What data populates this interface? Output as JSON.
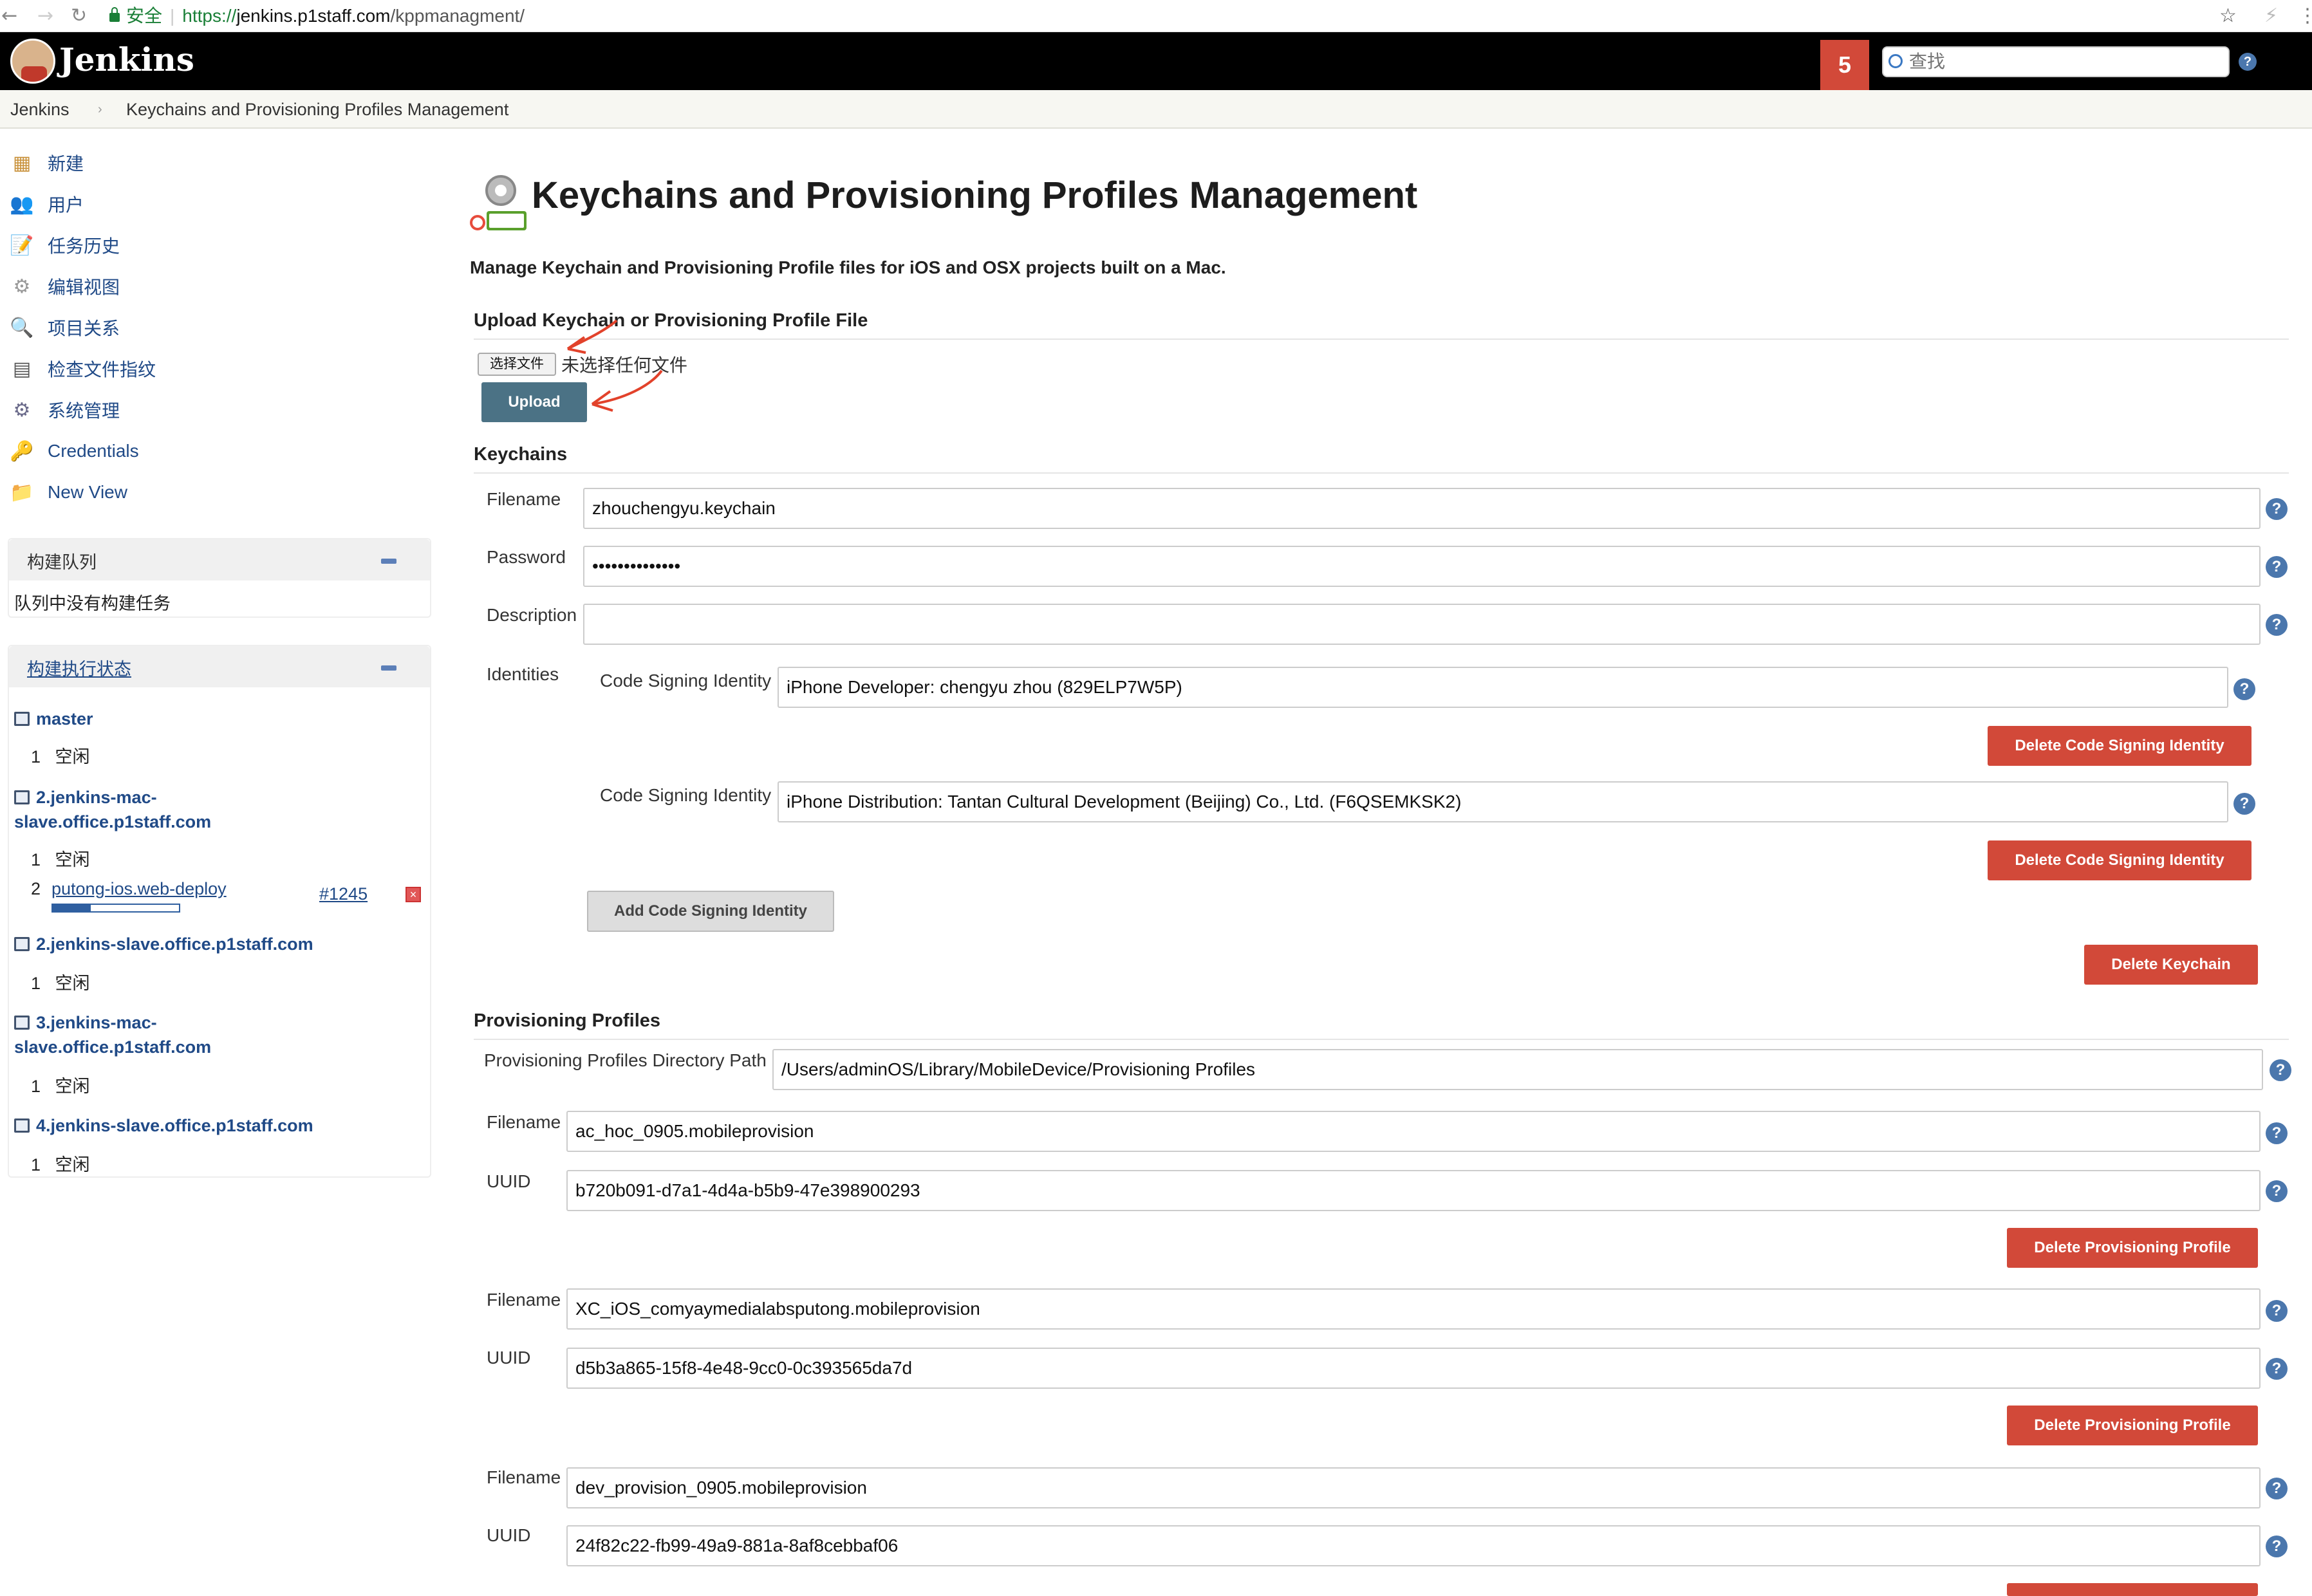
{
  "browser": {
    "secure_label": "安全",
    "url_scheme": "https://",
    "url_host": "jenkins.p1staff.com",
    "url_path": "/kppmanagment/"
  },
  "header": {
    "app_name": "Jenkins",
    "notification_count": "5",
    "search_placeholder": "查找"
  },
  "breadcrumb": [
    "Jenkins",
    "Keychains and Provisioning Profiles Management"
  ],
  "sidebar": {
    "tasks": [
      {
        "label": "新建",
        "icon": "new-item-icon"
      },
      {
        "label": "用户",
        "icon": "users-icon"
      },
      {
        "label": "任务历史",
        "icon": "build-history-icon"
      },
      {
        "label": "编辑视图",
        "icon": "edit-view-icon"
      },
      {
        "label": "项目关系",
        "icon": "project-relationship-icon"
      },
      {
        "label": "检查文件指纹",
        "icon": "fingerprint-icon"
      },
      {
        "label": "系统管理",
        "icon": "manage-jenkins-icon"
      },
      {
        "label": "Credentials",
        "icon": "credentials-icon"
      },
      {
        "label": "New View",
        "icon": "new-view-icon"
      }
    ],
    "build_queue": {
      "title": "构建队列",
      "empty_text": "队列中没有构建任务"
    },
    "executors": {
      "title": "构建执行状态",
      "nodes": [
        {
          "name_line1": "master",
          "name_line2": "",
          "executors": [
            {
              "index": "1",
              "status": "空闲"
            }
          ]
        },
        {
          "name_line1": "2.jenkins-mac-",
          "name_line2": "slave.office.p1staff.com",
          "executors": [
            {
              "index": "1",
              "status": "空闲"
            },
            {
              "index": "2",
              "job": "putong-ios.web-deploy",
              "build": "#1245",
              "progress": 0.3
            }
          ]
        },
        {
          "name_line1": "2.jenkins-slave.office.p1staff.com",
          "name_line2": "",
          "executors": [
            {
              "index": "1",
              "status": "空闲"
            }
          ]
        },
        {
          "name_line1": "3.jenkins-mac-",
          "name_line2": "slave.office.p1staff.com",
          "executors": [
            {
              "index": "1",
              "status": "空闲"
            }
          ]
        },
        {
          "name_line1": "4.jenkins-slave.office.p1staff.com",
          "name_line2": "",
          "executors": [
            {
              "index": "1",
              "status": "空闲"
            }
          ]
        }
      ]
    }
  },
  "main": {
    "title": "Keychains and Provisioning Profiles Management",
    "description": "Manage Keychain and Provisioning Profile files for iOS and OSX projects built on a Mac.",
    "upload": {
      "heading": "Upload Keychain or Provisioning Profile File",
      "choose_file_label": "选择文件",
      "no_file_text": "未选择任何文件",
      "upload_button": "Upload"
    },
    "keychains": {
      "heading": "Keychains",
      "filename_label": "Filename",
      "filename_value": "zhouchengyu.keychain",
      "password_label": "Password",
      "password_value": "••••••••••••••",
      "description_label": "Description",
      "description_value": "",
      "identities_label": "Identities",
      "identity_label": "Code Signing Identity",
      "identities": [
        "iPhone Developer: chengyu zhou (829ELP7W5P)",
        "iPhone Distribution: Tantan Cultural Development (Beijing) Co., Ltd. (F6QSEMKSK2)"
      ],
      "delete_identity_button": "Delete Code Signing Identity",
      "add_identity_button": "Add Code Signing Identity",
      "delete_keychain_button": "Delete Keychain"
    },
    "profiles": {
      "heading": "Provisioning Profiles",
      "dir_label": "Provisioning Profiles Directory Path",
      "dir_value": "/Users/adminOS/Library/MobileDevice/Provisioning Profiles",
      "filename_label": "Filename",
      "uuid_label": "UUID",
      "delete_button": "Delete Provisioning Profile",
      "items": [
        {
          "filename": "ac_hoc_0905.mobileprovision",
          "uuid": "b720b091-d7a1-4d4a-b5b9-47e398900293"
        },
        {
          "filename": "XC_iOS_comyaymedialabsputong.mobileprovision",
          "uuid": "d5b3a865-15f8-4e48-9cc0-0c393565da7d"
        },
        {
          "filename": "dev_provision_0905.mobileprovision",
          "uuid": "24f82c22-fb99-49a9-881a-8af8cebbaf06"
        }
      ]
    },
    "help_glyph": "?"
  },
  "colors": {
    "header_bg": "#000000",
    "danger": "#d24939",
    "upload_btn": "#4b7285",
    "link": "#204a87"
  }
}
